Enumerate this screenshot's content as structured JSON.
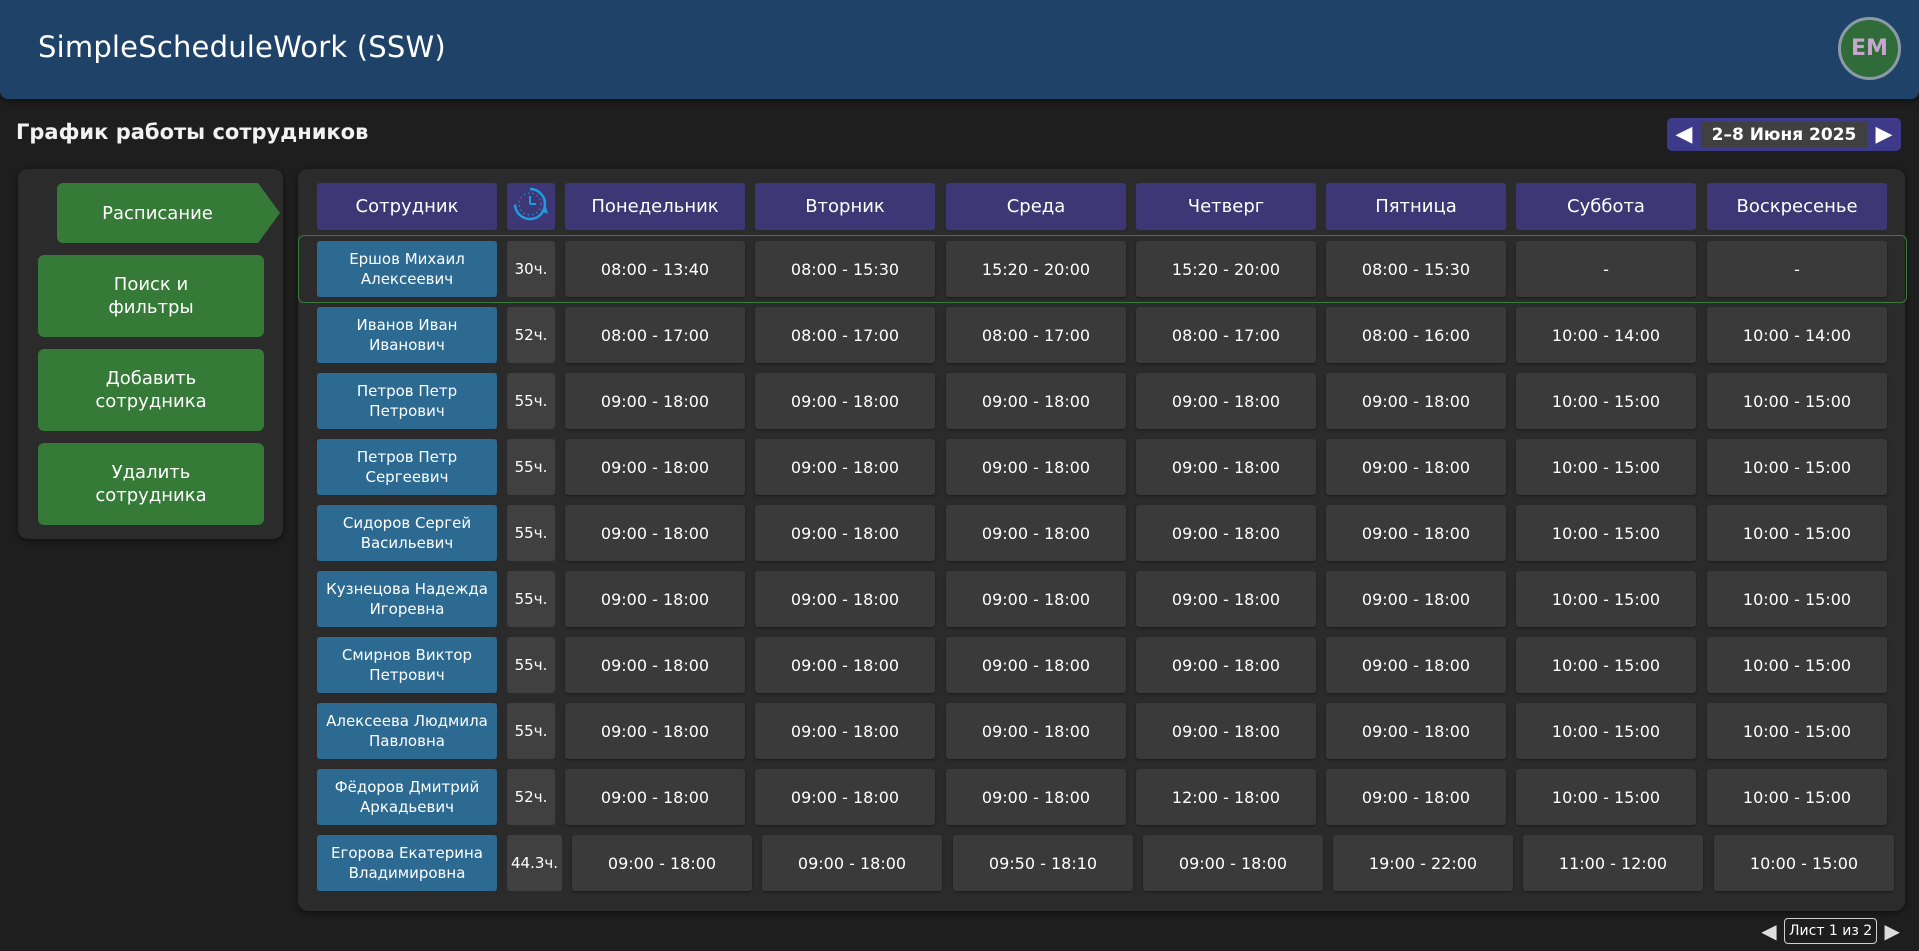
{
  "header": {
    "app_title": "SimpleScheduleWork (SSW)",
    "avatar_initials": "ЕМ"
  },
  "page": {
    "title": "График работы сотрудников"
  },
  "week_nav": {
    "label": "2–8 Июня 2025",
    "prev": "◀",
    "next": "▶"
  },
  "sidebar": {
    "items": [
      {
        "label": "Расписание",
        "active": true
      },
      {
        "label": "Поиск и фильтры"
      },
      {
        "label": "Добавить сотрудника"
      },
      {
        "label": "Удалить сотрудника"
      }
    ]
  },
  "table": {
    "headers": {
      "employee": "Сотрудник",
      "hours_icon": "clock-refresh-icon"
    },
    "days": [
      "Понедельник",
      "Вторник",
      "Среда",
      "Четверг",
      "Пятница",
      "Суббота",
      "Воскресенье"
    ],
    "rows": [
      {
        "name": "Ершов Михаил Алексеевич",
        "hours": "30ч.",
        "times": [
          "08:00 - 13:40",
          "08:00 - 15:30",
          "15:20 - 20:00",
          "15:20 - 20:00",
          "08:00 - 15:30",
          "-",
          "-"
        ]
      },
      {
        "name": "Иванов Иван Иванович",
        "hours": "52ч.",
        "times": [
          "08:00 - 17:00",
          "08:00 - 17:00",
          "08:00 - 17:00",
          "08:00 - 17:00",
          "08:00 - 16:00",
          "10:00 - 14:00",
          "10:00 - 14:00"
        ]
      },
      {
        "name": "Петров Петр Петрович",
        "hours": "55ч.",
        "times": [
          "09:00 - 18:00",
          "09:00 - 18:00",
          "09:00 - 18:00",
          "09:00 - 18:00",
          "09:00 - 18:00",
          "10:00 - 15:00",
          "10:00 - 15:00"
        ]
      },
      {
        "name": "Петров Петр Сергеевич",
        "hours": "55ч.",
        "times": [
          "09:00 - 18:00",
          "09:00 - 18:00",
          "09:00 - 18:00",
          "09:00 - 18:00",
          "09:00 - 18:00",
          "10:00 - 15:00",
          "10:00 - 15:00"
        ]
      },
      {
        "name": "Сидоров Сергей Васильевич",
        "hours": "55ч.",
        "times": [
          "09:00 - 18:00",
          "09:00 - 18:00",
          "09:00 - 18:00",
          "09:00 - 18:00",
          "09:00 - 18:00",
          "10:00 - 15:00",
          "10:00 - 15:00"
        ]
      },
      {
        "name": "Кузнецова Надежда Игоревна",
        "hours": "55ч.",
        "times": [
          "09:00 - 18:00",
          "09:00 - 18:00",
          "09:00 - 18:00",
          "09:00 - 18:00",
          "09:00 - 18:00",
          "10:00 - 15:00",
          "10:00 - 15:00"
        ]
      },
      {
        "name": "Смирнов Виктор Петрович",
        "hours": "55ч.",
        "times": [
          "09:00 - 18:00",
          "09:00 - 18:00",
          "09:00 - 18:00",
          "09:00 - 18:00",
          "09:00 - 18:00",
          "10:00 - 15:00",
          "10:00 - 15:00"
        ]
      },
      {
        "name": "Алексеева Людмила Павловна",
        "hours": "55ч.",
        "times": [
          "09:00 - 18:00",
          "09:00 - 18:00",
          "09:00 - 18:00",
          "09:00 - 18:00",
          "09:00 - 18:00",
          "10:00 - 15:00",
          "10:00 - 15:00"
        ]
      },
      {
        "name": "Фёдоров Дмитрий Аркадьевич",
        "hours": "52ч.",
        "times": [
          "09:00 - 18:00",
          "09:00 - 18:00",
          "09:00 - 18:00",
          "12:00 - 18:00",
          "09:00 - 18:00",
          "10:00 - 15:00",
          "10:00 - 15:00"
        ]
      },
      {
        "name": "Егорова Екатерина Владимировна",
        "hours": "44.3ч.",
        "times": [
          "09:00 - 18:00",
          "09:00 - 18:00",
          "09:50 - 18:10",
          "09:00 - 18:00",
          "19:00 - 22:00",
          "11:00 - 12:00",
          "10:00 - 15:00"
        ]
      }
    ]
  },
  "pager": {
    "label": "Лист 1 из 2",
    "prev": "◀",
    "next": "▶"
  },
  "colors": {
    "header_bg": "#1f4268",
    "accent_green": "#357a37",
    "header_purple": "#3d3875",
    "employee_blue": "#2d6a92"
  }
}
